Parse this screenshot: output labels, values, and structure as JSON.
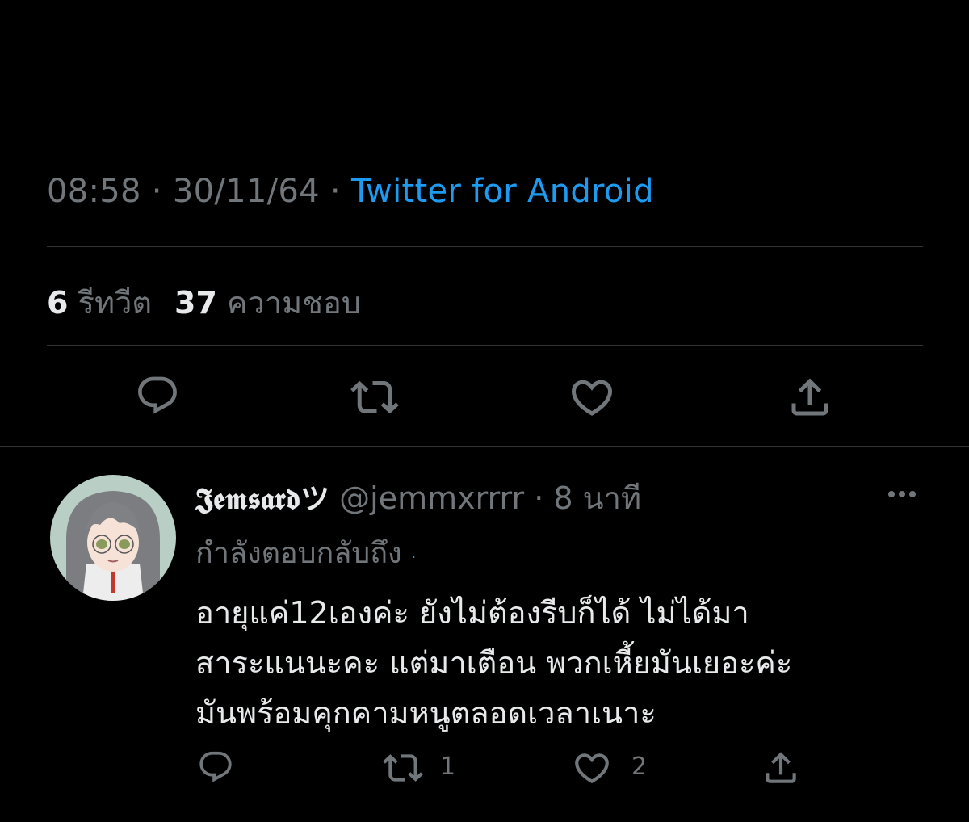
{
  "tweet": {
    "time": "08:58",
    "sep1": " · ",
    "date": "30/11/64",
    "sep2": " · ",
    "source": "Twitter for Android",
    "retweets_count": "6",
    "retweets_label": "รีทวีต",
    "likes_count": "37",
    "likes_label": "ความชอบ"
  },
  "reply": {
    "display_name": "𝕵𝖊𝖒𝖘𝖆𝖗𝖉ツ",
    "handle": "@jemmxrrrr",
    "sep": " · ",
    "time": "8 นาที",
    "replying_label": "กำลังตอบกลับถึง",
    "replying_target": "·",
    "body_lines": [
      "อายุแค่12เองค่ะ ยังไม่ต้องรีบก็ได้ ไม่ได้มา",
      "สาระแนนะคะ แต่มาเตือน พวกเหี้ยมันเยอะค่ะ",
      "มันพร้อมคุกคามหนูตลอดเวลาเนาะ"
    ],
    "retweet_count": "1",
    "like_count": "2"
  },
  "icons": {
    "reply": "reply-icon",
    "retweet": "retweet-icon",
    "like": "heart-icon",
    "share": "share-icon",
    "more": "more-icon"
  },
  "colors": {
    "background": "#000000",
    "text": "#e7e9ea",
    "secondary": "#71767b",
    "accent": "#1d9bf0",
    "divider": "#2f3336"
  }
}
